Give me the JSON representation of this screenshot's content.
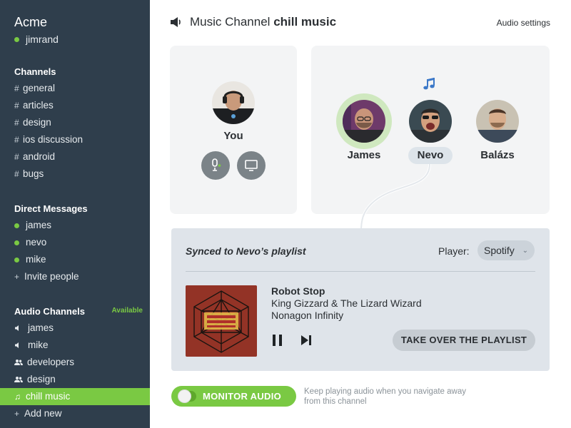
{
  "sidebar": {
    "workspace": "Acme",
    "current_user": "jimrand",
    "channels_title": "Channels",
    "channels": [
      "general",
      "articles",
      "design",
      "ios discussion",
      "android",
      "bugs"
    ],
    "dm_title": "Direct Messages",
    "dms": [
      "james",
      "nevo",
      "mike"
    ],
    "invite_label": "Invite people",
    "audio_title": "Audio Channels",
    "audio_status": "Available",
    "audio_channels": [
      "james",
      "mike",
      "developers",
      "design",
      "chill music"
    ],
    "add_new_label": "Add new"
  },
  "header": {
    "prefix": "Music Channel",
    "channel": "chill music",
    "audio_settings": "Audio settings"
  },
  "participants": {
    "you": "You",
    "others": [
      "James",
      "Nevo",
      "Balázs"
    ]
  },
  "playlist": {
    "synced_text": "Synced to Nevo’s playlist",
    "player_label": "Player:",
    "player_value": "Spotify",
    "track_title": "Robot Stop",
    "track_artist": "King Gizzard & The Lizard Wizard",
    "track_album": "Nonagon Infinity",
    "takeover_label": "TAKE OVER THE PLAYLIST"
  },
  "monitor": {
    "label": "MONITOR AUDIO",
    "description": "Keep playing audio when you navigate away from this channel"
  },
  "colors": {
    "sidebar_bg": "#2f3e4c",
    "accent_green": "#7ac943",
    "card_bg": "#f3f4f5",
    "panel_bg": "#dfe4ea",
    "note_blue": "#3b78c8"
  }
}
